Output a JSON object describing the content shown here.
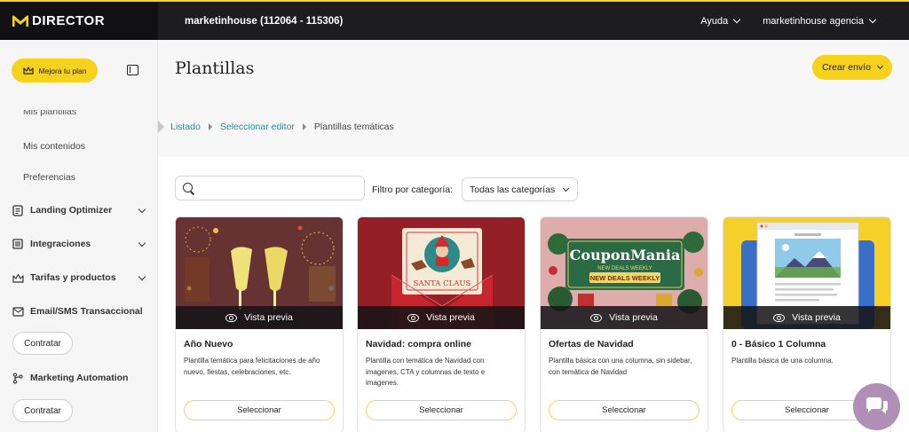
{
  "brand": {
    "logo_text": "DIRECTOR",
    "accent": "#f7d21c",
    "dark": "#1d1d1f"
  },
  "header": {
    "account": "marketinhouse (112064 - 115306)",
    "help_label": "Ayuda",
    "user_label": "marketinhouse agencia"
  },
  "sidebar": {
    "upgrade_label": "Mejora tu plan",
    "clipped_label": "Mis plantillas",
    "sub_items": [
      {
        "label": "Mis contenidos"
      },
      {
        "label": "Preferencias"
      }
    ],
    "items": [
      {
        "label": "Landing Optimizer",
        "icon": "document-icon",
        "expandable": true
      },
      {
        "label": "Integraciones",
        "icon": "list-icon",
        "expandable": true
      },
      {
        "label": "Tarifas y productos",
        "icon": "crown-icon",
        "expandable": true
      },
      {
        "label": "Email/SMS Transaccional",
        "icon": "mail-icon",
        "expandable": false
      },
      {
        "label": "Marketing Automation",
        "icon": "flow-icon",
        "expandable": false
      }
    ],
    "contract_label": "Contratar"
  },
  "main": {
    "title": "Plantillas",
    "create_label": "Crear envío",
    "breadcrumb": [
      "Listado",
      "Seleccionar editor",
      "Plantillas temáticas"
    ],
    "search_placeholder": "",
    "filter_label": "Filtro por categoría:",
    "filter_value": "Todas las categorías"
  },
  "cards": [
    {
      "title": "Año Nuevo",
      "description": "Plantilla temática para felicitaciones de año nuevo, fiestas, celebraciones, etc.",
      "preview_label": "Vista previa",
      "select_label": "Seleccionar"
    },
    {
      "title": "Navidad: compra online",
      "description": "Plantilla con temática de Navidad con imagenes, CTA y columnas de texto e imagenes.",
      "preview_label": "Vista previa",
      "select_label": "Seleccionar",
      "thumb_text": "SANTA CLAUS"
    },
    {
      "title": "Ofertas de Navidad",
      "description": "Plantilla básica con una columna, sin sidebar, con temática de Navidad",
      "preview_label": "Vista previa",
      "select_label": "Seleccionar",
      "thumb_text": "CouponMania",
      "thumb_sub": "NEW DEALS WEEKLY",
      "thumb_banner": "NEW DEALS WEEKLY"
    },
    {
      "title": "0 - Básico 1 Columna",
      "description": "Plantilla básica de una columna.",
      "preview_label": "Vista previa",
      "select_label": "Seleccionar"
    }
  ]
}
